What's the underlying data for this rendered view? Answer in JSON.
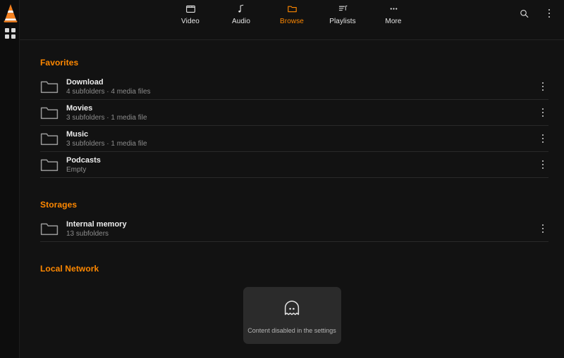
{
  "app": {
    "logo_icon": "vlc-cone-logo",
    "grid_icon": "grid-view-icon",
    "accent_color": "#ff8800",
    "background_color": "#121212",
    "card_color": "#2b2b2b"
  },
  "header": {
    "nav": [
      {
        "label": "Video",
        "icon": "video-icon",
        "active": false
      },
      {
        "label": "Audio",
        "icon": "audio-icon",
        "active": false
      },
      {
        "label": "Browse",
        "icon": "folder-icon",
        "active": true
      },
      {
        "label": "Playlists",
        "icon": "playlists-icon",
        "active": false
      },
      {
        "label": "More",
        "icon": "more-icon",
        "active": false
      }
    ],
    "search_icon": "search-icon",
    "overflow_icon": "kebab-menu-icon"
  },
  "sections": [
    {
      "title": "Favorites",
      "items": [
        {
          "name": "Download",
          "subtitle": "4 subfolders · 4 media files"
        },
        {
          "name": "Movies",
          "subtitle": "3 subfolders · 1 media file"
        },
        {
          "name": "Music",
          "subtitle": "3 subfolders · 1 media file"
        },
        {
          "name": "Podcasts",
          "subtitle": "Empty"
        }
      ]
    },
    {
      "title": "Storages",
      "items": [
        {
          "name": "Internal memory",
          "subtitle": "13 subfolders"
        }
      ]
    },
    {
      "title": "Local Network",
      "empty_state": {
        "icon": "ghost-icon",
        "message": "Content disabled in the settings"
      }
    }
  ]
}
